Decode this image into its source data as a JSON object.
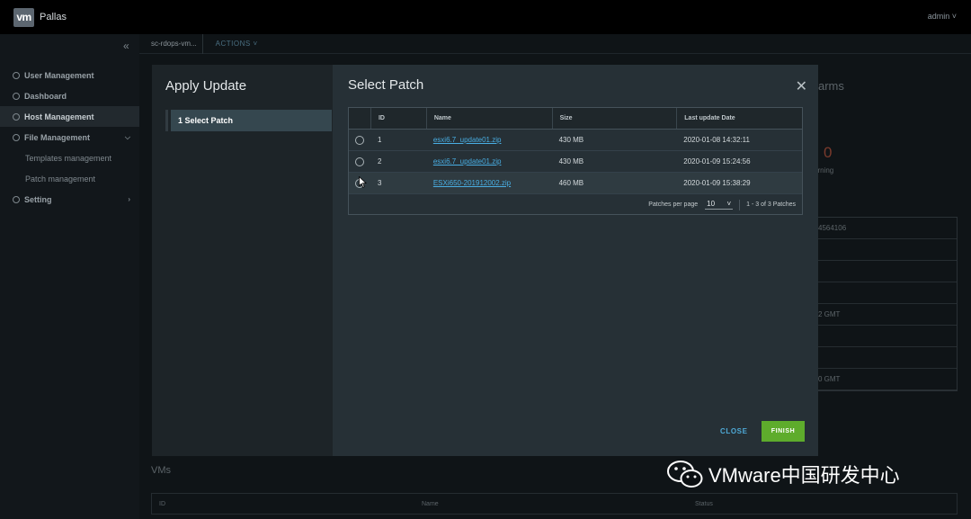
{
  "header": {
    "logo": "vm",
    "app_name": "Pallas",
    "user": "admin ˅"
  },
  "sidebar": {
    "collapse_icon": "«",
    "items": [
      {
        "label": "User Management"
      },
      {
        "label": "Dashboard"
      },
      {
        "label": "Host Management"
      },
      {
        "label": "File Management"
      },
      {
        "label": "Templates management"
      },
      {
        "label": "Patch management"
      },
      {
        "label": "Setting"
      }
    ]
  },
  "background": {
    "tab": "sc-rdops-vm...",
    "actions": "ACTIONS ˅",
    "alarms_partial": "arms",
    "zero_count": "0",
    "warning_partial": "arning",
    "table_cells": [
      "4564106",
      "",
      "",
      "",
      "2 GMT",
      "",
      "",
      "0 GMT"
    ],
    "vms_title": "VMs",
    "vms_columns": [
      "ID",
      "Name",
      "Status"
    ]
  },
  "modal": {
    "wizard_title": "Apply Update",
    "step_label": "1  Select Patch",
    "title": "Select Patch",
    "close_icon": "✕",
    "columns": [
      "ID",
      "Name",
      "Size",
      "Last update Date"
    ],
    "rows": [
      {
        "id": "1",
        "name": "esxi6.7_update01.zip",
        "size": "430 MB",
        "date": "2020-01-08 14:32:11"
      },
      {
        "id": "2",
        "name": "esxi6.7_update01.zip",
        "size": "430 MB",
        "date": "2020-01-09 15:24:56"
      },
      {
        "id": "3",
        "name": "ESXi650-201912002.zip",
        "size": "460 MB",
        "date": "2020-01-09 15:38:29"
      }
    ],
    "footer": {
      "per_page_label": "Patches per page",
      "per_page_value": "10",
      "per_page_arrow": "˅",
      "range": "1 - 3 of 3 Patches"
    },
    "close_button": "CLOSE",
    "finish_button": "FINISH"
  },
  "watermark": {
    "text": "VMware中国研发中心",
    "icon": "wechat-icon"
  },
  "colors": {
    "primary": "#49aee3",
    "finish": "#5eac2c",
    "modal_bg": "#263036"
  }
}
